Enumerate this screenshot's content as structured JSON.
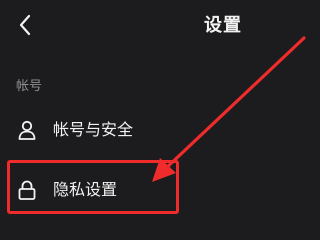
{
  "header": {
    "title": "设置",
    "back_icon": "chevron-left-icon"
  },
  "section_account": {
    "header": "帐号"
  },
  "items": [
    {
      "label": "帐号与安全",
      "icon": "person-icon"
    },
    {
      "label": "隐私设置",
      "icon": "lock-icon"
    }
  ],
  "annotation": {
    "color": "#f02b2b"
  },
  "colors": {
    "background": "#1c1c1e",
    "text": "#f2f2f2",
    "section_text": "#8e8e93"
  }
}
